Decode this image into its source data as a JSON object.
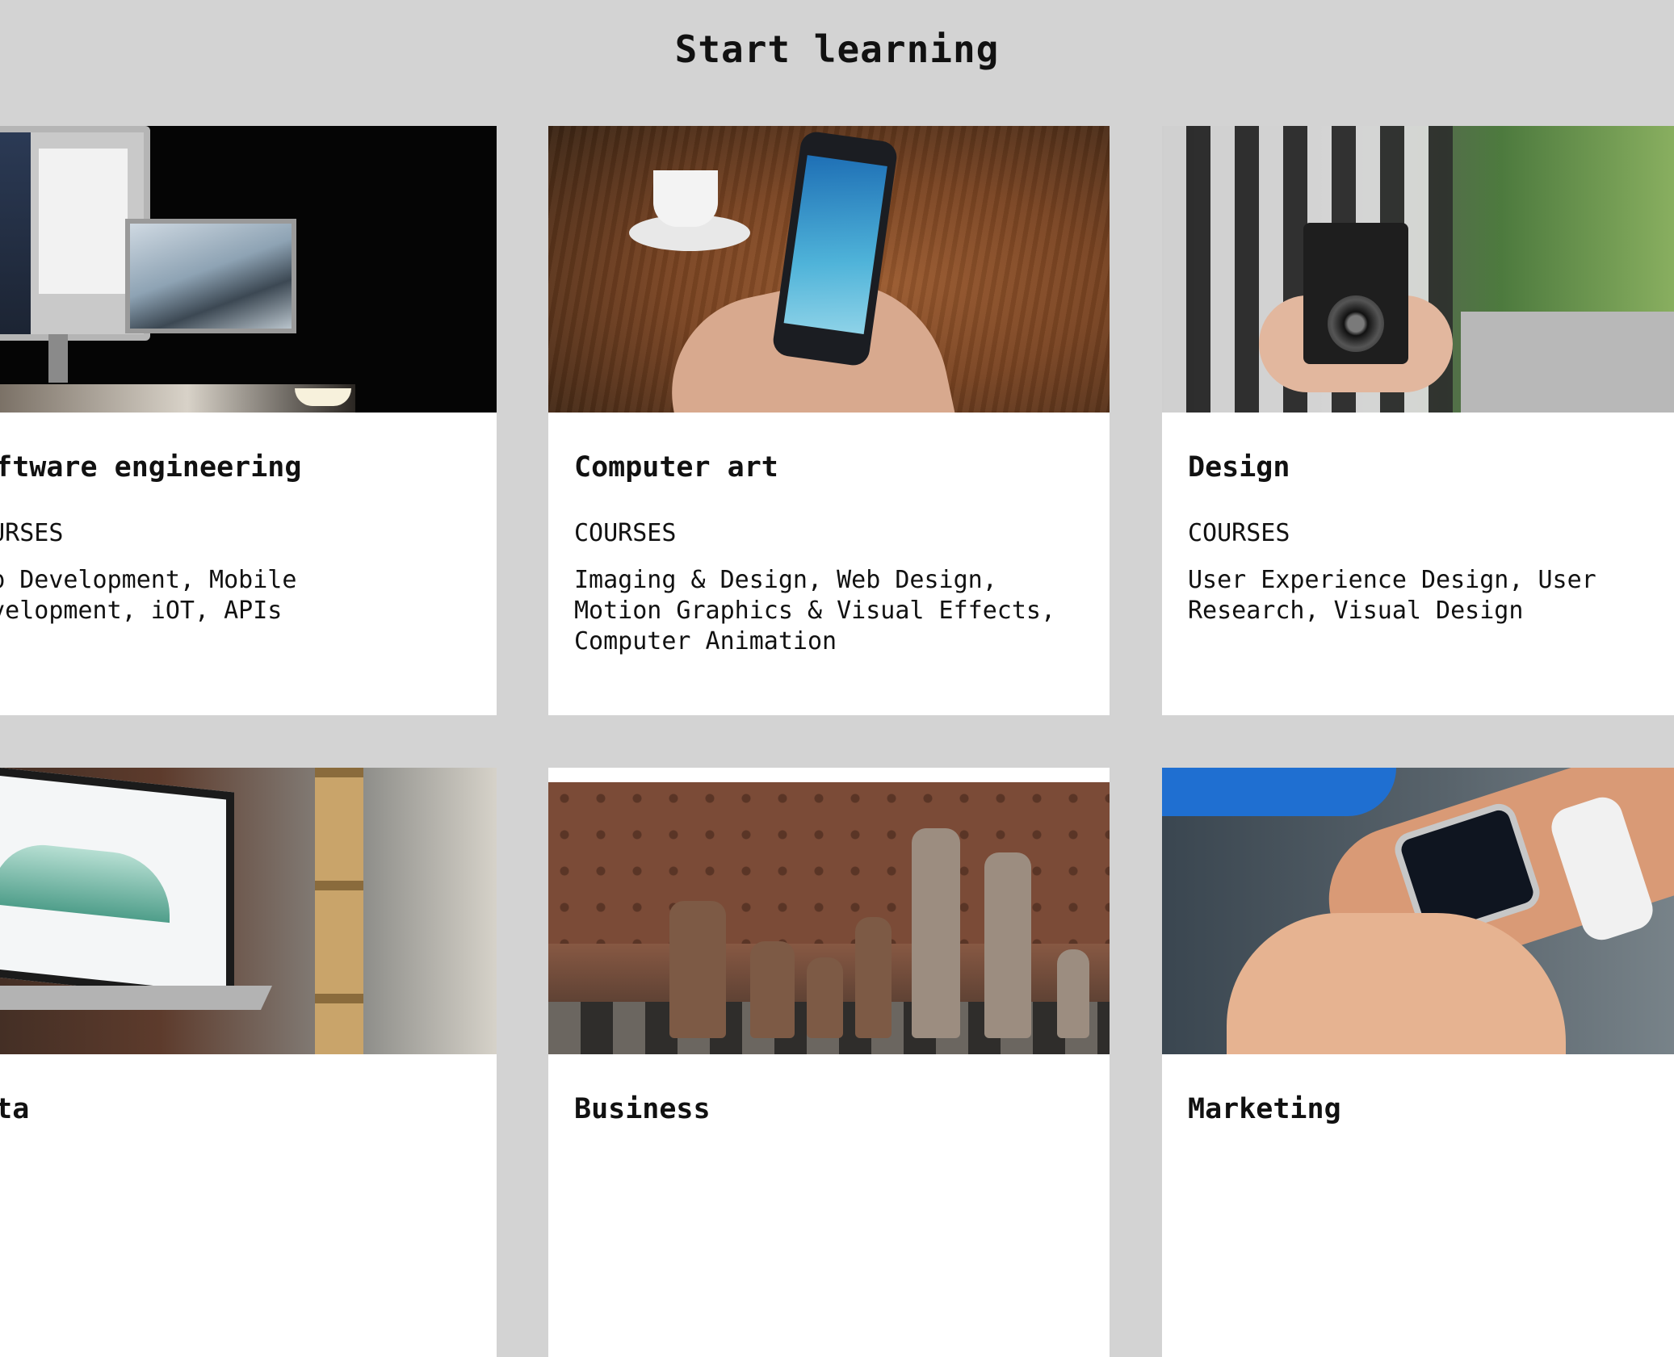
{
  "page": {
    "title": "Start learning"
  },
  "cards": [
    {
      "title": "Software engineering",
      "label": "COURSES",
      "courses": "Web Development, Mobile Development, iOT, APIs",
      "image_icon": "desk-computer-image"
    },
    {
      "title": "Computer art",
      "label": "COURSES",
      "courses": "Imaging & Design, Web Design, Motion Graphics & Visual Effects, Computer Animation",
      "image_icon": "smartphone-image"
    },
    {
      "title": "Design",
      "label": "COURSES",
      "courses": "User Experience Design, User Research, Visual Design",
      "image_icon": "camera-image"
    },
    {
      "title": "Data",
      "image_icon": "laptop-dashboard-image"
    },
    {
      "title": "Business",
      "image_icon": "chess-image"
    },
    {
      "title": "Marketing",
      "image_icon": "smartwatch-image"
    }
  ],
  "colors": {
    "page_background": "#d3d3d3",
    "card_background": "#ffffff",
    "text": "#111111"
  }
}
